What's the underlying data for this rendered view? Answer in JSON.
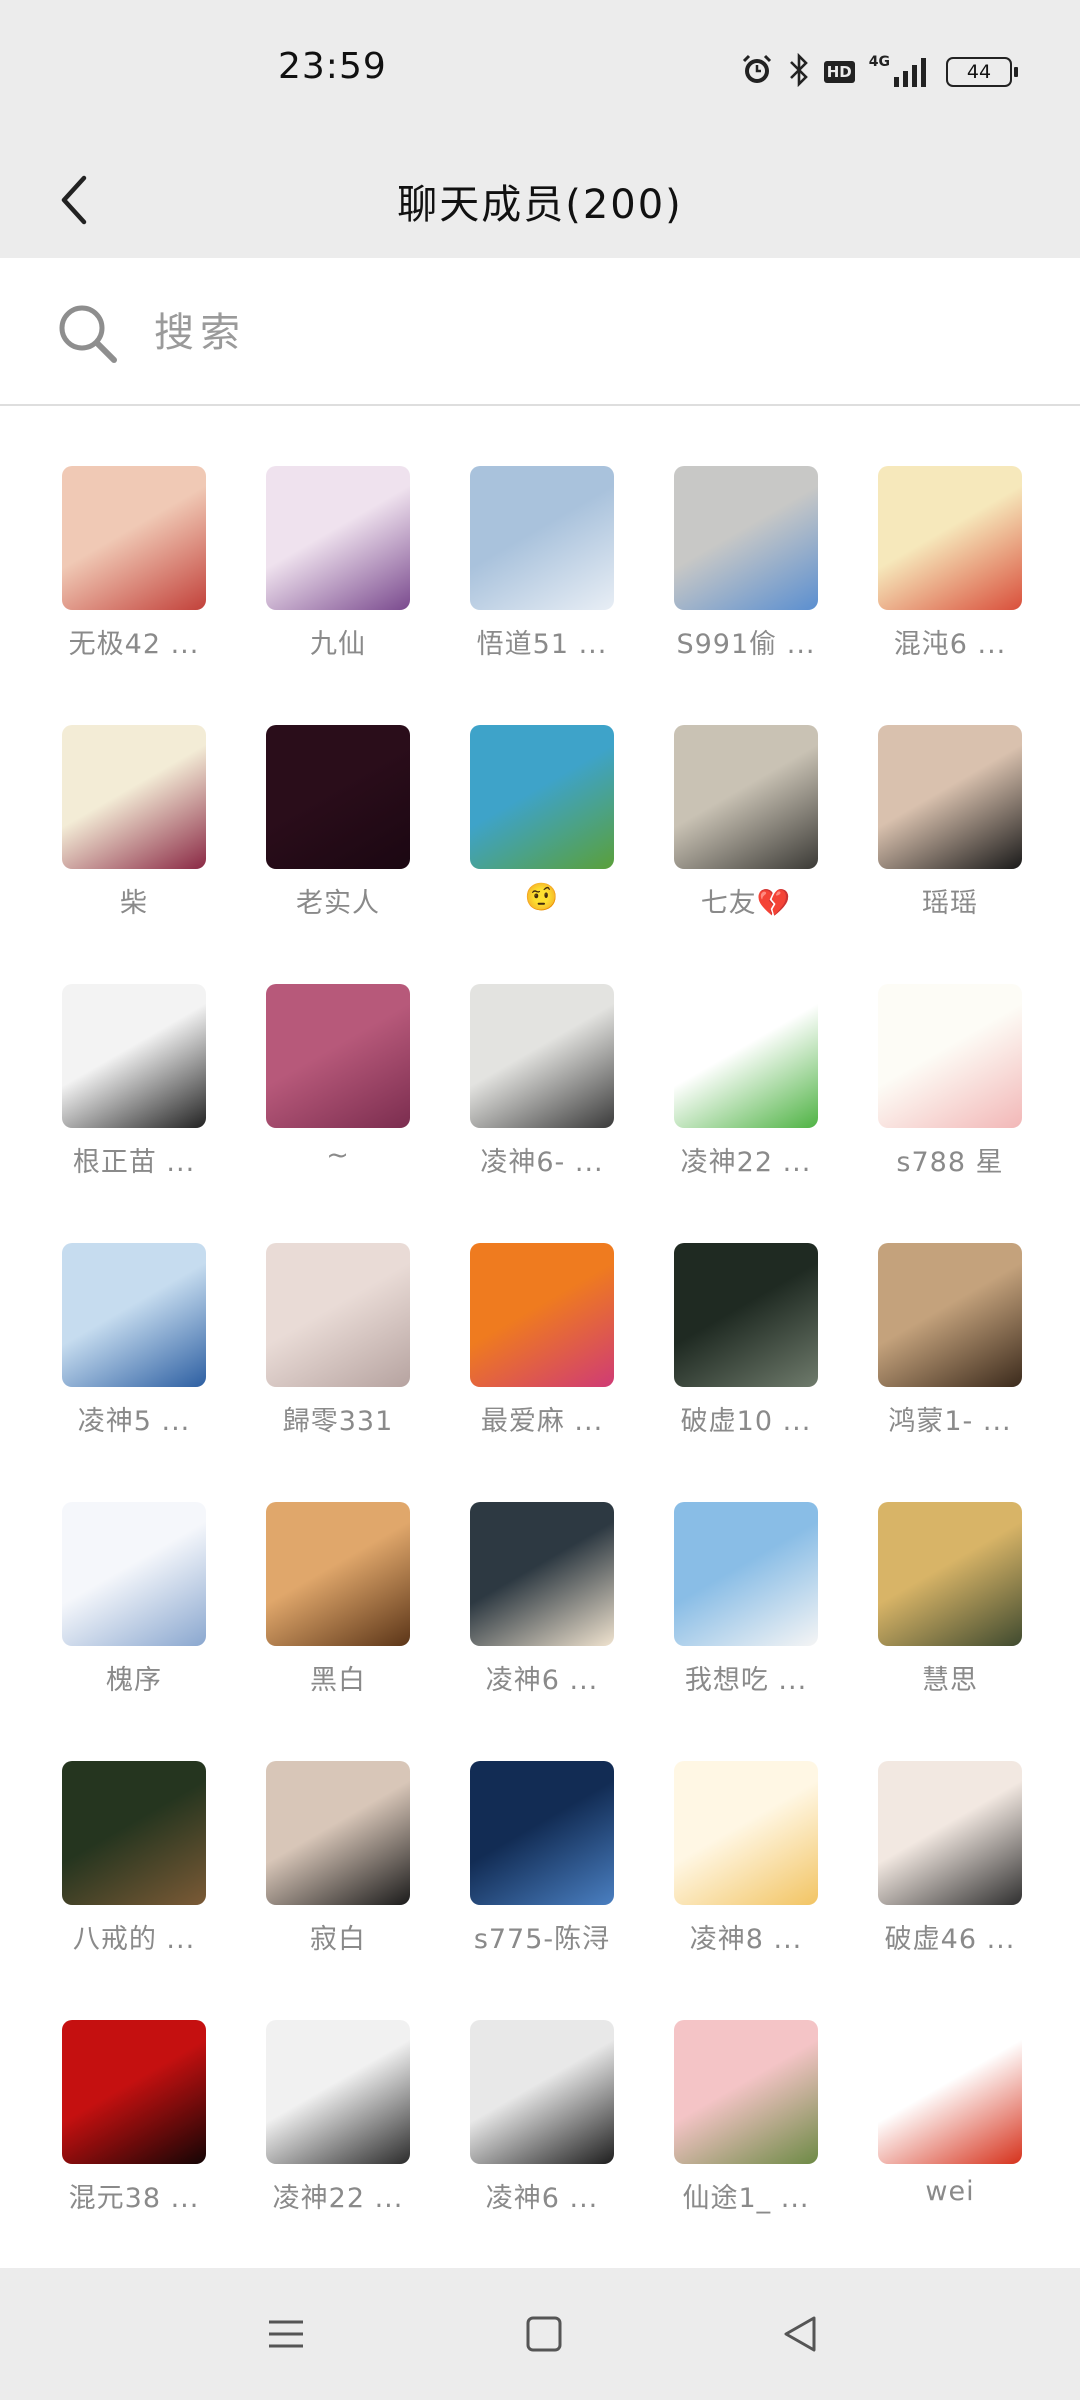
{
  "status": {
    "time": "23:59",
    "battery": "44",
    "network": "4G",
    "hd": "HD"
  },
  "header": {
    "title": "聊天成员(200)"
  },
  "search": {
    "placeholder": "搜索"
  },
  "members": [
    {
      "name": "无极42 ...",
      "colors": [
        "#f0c9b5",
        "#c2413a"
      ]
    },
    {
      "name": "九仙",
      "colors": [
        "#efe2ee",
        "#7a4a8e"
      ]
    },
    {
      "name": "悟道51 ...",
      "colors": [
        "#a9c2dc",
        "#e8eef5"
      ]
    },
    {
      "name": "S991偷 ...",
      "colors": [
        "#c8c8c6",
        "#5b8fd0"
      ]
    },
    {
      "name": "混沌6 ...",
      "colors": [
        "#f6e8bb",
        "#d94f3b"
      ]
    },
    {
      "name": "柴",
      "colors": [
        "#f3ecd6",
        "#8a2844"
      ]
    },
    {
      "name": "老实人",
      "colors": [
        "#2a0d1a",
        "#1b0712"
      ]
    },
    {
      "name": "🤨",
      "colors": [
        "#3ea3c9",
        "#5aa03a"
      ]
    },
    {
      "name": "七友💔",
      "colors": [
        "#c9c2b4",
        "#3b3a36"
      ]
    },
    {
      "name": "瑶瑶",
      "colors": [
        "#d9c1ae",
        "#1a1a1a"
      ]
    },
    {
      "name": "根正苗 ...",
      "colors": [
        "#f3f3f3",
        "#222222"
      ]
    },
    {
      "name": "~",
      "colors": [
        "#b7597a",
        "#7b2d4f"
      ]
    },
    {
      "name": "凌神6- ...",
      "colors": [
        "#e3e3e0",
        "#3a3a3a"
      ]
    },
    {
      "name": "凌神22 ...",
      "colors": [
        "#ffffff",
        "#4fb344"
      ]
    },
    {
      "name": "s788 星",
      "colors": [
        "#fdfcf6",
        "#f2b7b7"
      ]
    },
    {
      "name": "凌神5 ...",
      "colors": [
        "#c6dcef",
        "#2d5fa2"
      ]
    },
    {
      "name": "歸零331",
      "colors": [
        "#e9dbd6",
        "#b6a3a0"
      ]
    },
    {
      "name": "最爱麻 ...",
      "colors": [
        "#ef7b1f",
        "#cf3b75"
      ]
    },
    {
      "name": "破虚10 ...",
      "colors": [
        "#1f2a22",
        "#6f7b6c"
      ]
    },
    {
      "name": "鸿蒙1- ...",
      "colors": [
        "#c4a27c",
        "#3b2a1c"
      ]
    },
    {
      "name": "槐序",
      "colors": [
        "#f5f7fb",
        "#8aa7cf"
      ]
    },
    {
      "name": "黑白",
      "colors": [
        "#e0a76b",
        "#5b3518"
      ]
    },
    {
      "name": "凌神6 ...",
      "colors": [
        "#2d3942",
        "#f0e3cf"
      ]
    },
    {
      "name": "我想吃 ...",
      "colors": [
        "#89bde6",
        "#f5f5f5"
      ]
    },
    {
      "name": "慧思",
      "colors": [
        "#d8b467",
        "#3f4a2f"
      ]
    },
    {
      "name": "八戒的 ...",
      "colors": [
        "#25351f",
        "#7b5a36"
      ]
    },
    {
      "name": "寂白",
      "colors": [
        "#d8c6b8",
        "#1b1b1b"
      ]
    },
    {
      "name": "s775-陈浔",
      "colors": [
        "#122c54",
        "#4a7fc1"
      ]
    },
    {
      "name": "凌神8 ...",
      "colors": [
        "#fff7e4",
        "#f2c463"
      ]
    },
    {
      "name": "破虚46 ...",
      "colors": [
        "#f2e8e1",
        "#2f2f2f"
      ]
    },
    {
      "name": "混元38 ...",
      "colors": [
        "#c51010",
        "#140505"
      ]
    },
    {
      "name": "凌神22 ...",
      "colors": [
        "#f1f1f1",
        "#2c2c2c"
      ]
    },
    {
      "name": "凌神6 ...",
      "colors": [
        "#e8e8e8",
        "#1e1e1e"
      ]
    },
    {
      "name": "仙途1_ ...",
      "colors": [
        "#f4c4c6",
        "#6d8a45"
      ]
    },
    {
      "name": "wei",
      "colors": [
        "#ffffff",
        "#d6311b"
      ]
    }
  ],
  "nav": {
    "menu_icon": "menu-icon",
    "home_icon": "home-icon",
    "back_icon": "back-triangle-icon"
  }
}
